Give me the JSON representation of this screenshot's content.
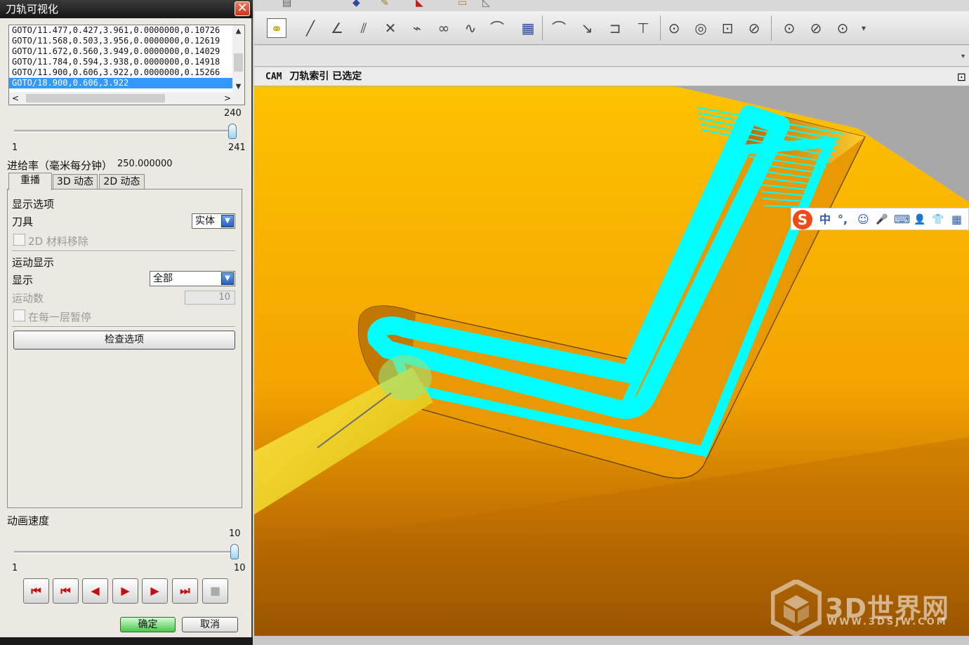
{
  "dialog": {
    "title": "刀轨可视化",
    "close_glyph": "✕",
    "list": {
      "rows": [
        "GOTO/11.477,0.427,3.961,0.0000000,0.10726",
        "GOTO/11.568,0.503,3.956,0.0000000,0.12619",
        "GOTO/11.672,0.560,3.949,0.0000000,0.14029",
        "GOTO/11.784,0.594,3.938,0.0000000,0.14918",
        "GOTO/11.900,0.606,3.922,0.0000000,0.15266",
        "GOTO/18.900,0.606,3.922"
      ],
      "selected_index": 5
    },
    "position_slider": {
      "value": "240",
      "min": "1",
      "max": "241",
      "fraction": 0.996
    },
    "feed_label": "进给率（毫米每分钟）",
    "feed_value": "250.000000",
    "tabs": [
      "重播",
      "3D 动态",
      "2D 动态"
    ],
    "active_tab": 0,
    "display_options": {
      "heading": "显示选项",
      "tool_label": "刀具",
      "tool_value": "实体",
      "material_removal_label": "2D 材料移除"
    },
    "motion_display": {
      "heading": "运动显示",
      "display_label": "显示",
      "display_value": "全部",
      "motion_count_label": "运动数",
      "motion_count_value": "10",
      "pause_label": "在每一层暂停"
    },
    "check_options_label": "检查选项",
    "anim_speed": {
      "label": "动画速度",
      "value": "10",
      "min": "1",
      "max": "10",
      "fraction": 1.0
    },
    "media": {
      "first": "⏮",
      "prev_op": "⏮",
      "step_back": "◀",
      "play": "▶",
      "step_fwd": "▶",
      "last": "⏭",
      "stop": "■"
    },
    "ok_label": "确定",
    "cancel_label": "取消"
  },
  "main": {
    "status_prefix": "CAM",
    "status_text": "刀轨索引 已选定"
  },
  "ime": {
    "logo": "S",
    "items": [
      "中",
      "°,",
      "☺",
      "🎤",
      "⌨",
      "👤",
      "👕",
      "▦"
    ]
  },
  "watermark": {
    "title": "3D世界网",
    "url": "WWW.3DSJW.COM"
  },
  "colors": {
    "material": "#fdc400",
    "toolpath": "#00ffff",
    "dialog_bg": "#ece9e3",
    "selection": "#3399ff"
  }
}
